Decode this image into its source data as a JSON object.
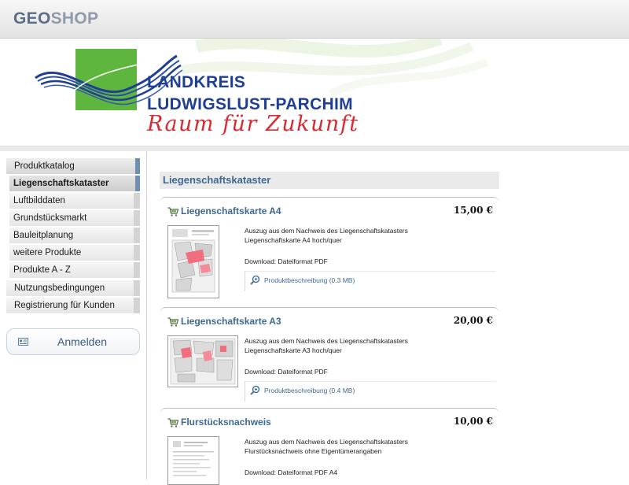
{
  "header": {
    "brand_part1": "GEO",
    "brand_part2": "SHOP"
  },
  "banner": {
    "line1": "LANDKREIS",
    "line2": "LUDWIGSLUST-PARCHIM",
    "slogan": "Raum für Zukunft",
    "colors": {
      "green": "#5fb63e",
      "blue": "#1f3f95",
      "red": "#d62b31"
    }
  },
  "sidebar": {
    "items": [
      {
        "label": "Produktkatalog",
        "level": 1
      },
      {
        "label": "Liegenschaftskataster",
        "level": 2
      },
      {
        "label": "Luftbilddaten",
        "level": 2
      },
      {
        "label": "Grundstücksmarkt",
        "level": 2
      },
      {
        "label": "Bauleitplanung",
        "level": 2
      },
      {
        "label": "weitere Produkte",
        "level": 2
      },
      {
        "label": "Produkte A - Z",
        "level": 2
      },
      {
        "label": "Nutzungsbedingungen",
        "level": 1
      },
      {
        "label": "Registrierung für Kunden",
        "level": 1
      }
    ],
    "login_label": "Anmelden"
  },
  "main": {
    "section_title": "Liegenschaftskataster",
    "products": [
      {
        "title": "Liegenschaftskarte A4",
        "price": "15,00 €",
        "desc1": "Auszug aus dem Nachweis des Liegenschaftskatasters",
        "desc2": "Liegenschaftskarte A4 hoch/quer",
        "download": "Download: Dateiformat PDF",
        "link": "Produktbeschreibung (0.3 MB)"
      },
      {
        "title": "Liegenschaftskarte A3",
        "price": "20,00 €",
        "desc1": "Auszug aus dem Nachweis des Liegenschaftskatasters",
        "desc2": "Liegenschaftskarte A3 hoch/quer",
        "download": "Download: Dateiformat PDF",
        "link": "Produktbeschreibung (0.4 MB)"
      },
      {
        "title": "Flurstücksnachweis",
        "price": "10,00 €",
        "desc1": "Auszug aus dem Nachweis des Liegenschaftskatasters",
        "desc2": "Flurstücksnachweis ohne Eigentümerangaben",
        "download": "Download: Dateiformat PDF A4"
      }
    ]
  },
  "colors": {
    "accent": "#3d6891",
    "nav_rail_active": "#6e8fb3"
  }
}
